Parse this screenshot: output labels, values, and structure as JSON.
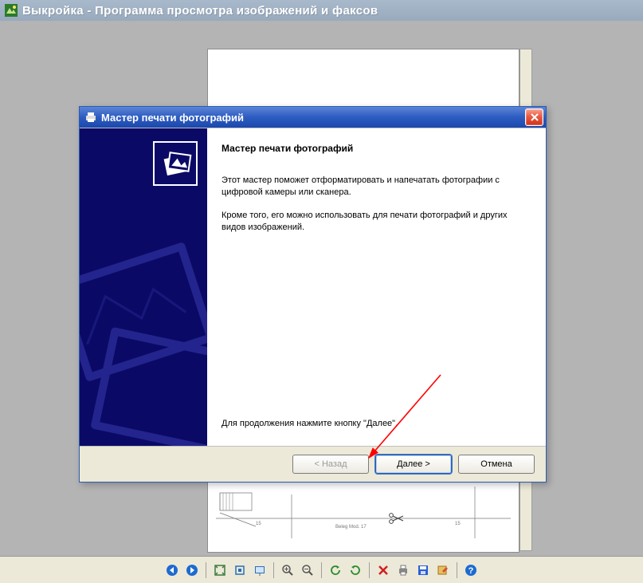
{
  "main_window": {
    "title": "Выкройка - Программа просмотра изображений и факсов"
  },
  "wizard": {
    "title": "Мастер печати фотографий",
    "heading": "Мастер печати фотографий",
    "para1": "Этот мастер поможет отформатировать и напечатать фотографии с цифровой камеры или сканера.",
    "para2": "Кроме того, его можно использовать для печати фотографий и других видов изображений.",
    "continue_hint": "Для продолжения нажмите кнопку \"Далее\".",
    "buttons": {
      "back": "< Назад",
      "next": "Далее >",
      "cancel": "Отмена"
    }
  },
  "toolbar": {
    "items": [
      "prev-image",
      "next-image",
      "SEP",
      "fit-window",
      "actual-size",
      "slideshow",
      "SEP",
      "zoom-in",
      "zoom-out",
      "SEP",
      "rotate-ccw",
      "rotate-cw",
      "SEP",
      "delete",
      "print",
      "save",
      "open-editor",
      "SEP",
      "help"
    ]
  },
  "doc_label": "Beleg Mod. 17"
}
